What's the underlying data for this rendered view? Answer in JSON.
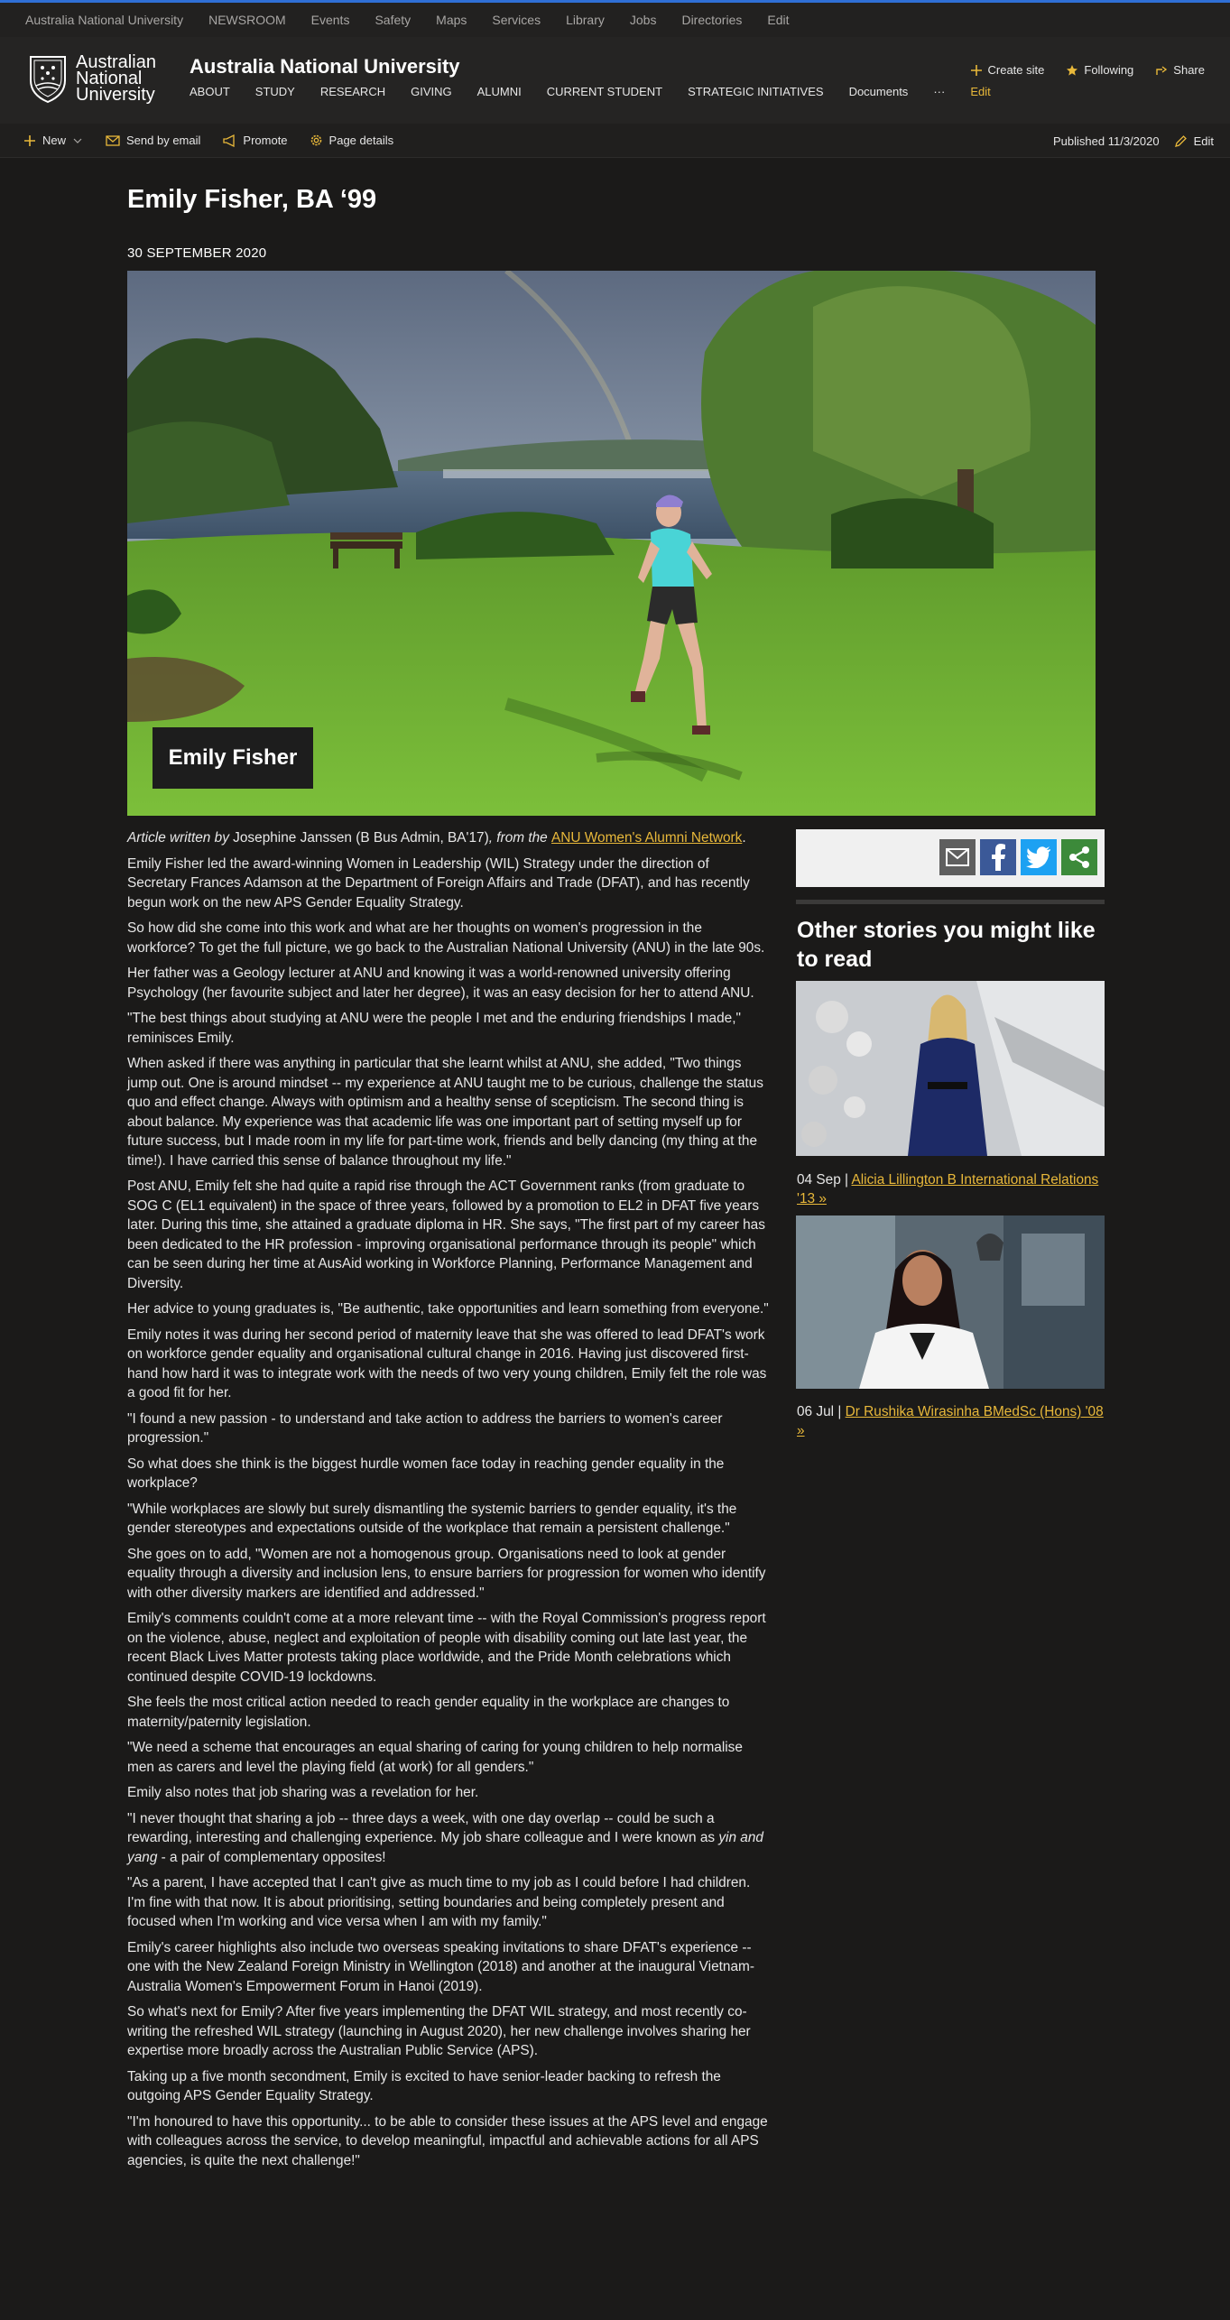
{
  "suite_bar": {
    "links": [
      "Australia National University",
      "NEWSROOM",
      "Events",
      "Safety",
      "Maps",
      "Services",
      "Library",
      "Jobs",
      "Directories",
      "Edit"
    ]
  },
  "site_header": {
    "logo_text": [
      "Australian",
      "National",
      "University"
    ],
    "title": "Australia National University",
    "nav": [
      "ABOUT",
      "STUDY",
      "RESEARCH",
      "GIVING",
      "ALUMNI",
      "CURRENT STUDENT",
      "STRATEGIC INITIATIVES",
      "Documents",
      "···",
      "Edit"
    ],
    "actions": {
      "create_site": "Create site",
      "following": "Following",
      "share": "Share"
    }
  },
  "command_bar": {
    "new": "New",
    "send_by_email": "Send by email",
    "promote": "Promote",
    "page_details": "Page details",
    "published": "Published 11/3/2020",
    "edit": "Edit"
  },
  "page": {
    "title": "Emily Fisher, BA ‘99",
    "date": "30 SEPTEMBER 2020",
    "hero_caption": "Emily Fisher"
  },
  "article": {
    "byline_prefix": "Article written by",
    "byline_author": " Josephine Janssen (B Bus Admin, BA'17)",
    "byline_mid": ", from the ",
    "byline_link": "ANU Women's Alumni Network",
    "byline_end": ".",
    "paragraphs": [
      "Emily Fisher led the award-winning Women in Leadership (WIL) Strategy under the direction of Secretary Frances Adamson at the Department of Foreign Affairs and Trade (DFAT), and has recently begun work on the new APS Gender Equality Strategy.",
      "So how did she come into this work and what are her thoughts on women's progression in the workforce? To get the full picture, we go back to the Australian National University (ANU) in the late 90s.",
      "Her father was a Geology lecturer at ANU and knowing it was a world-renowned university offering Psychology (her favourite subject and later her degree), it was an easy decision for her to attend ANU.",
      "\"The best things about studying at ANU were the people I met and the enduring friendships I made,\" reminisces Emily.",
      "When asked if there was anything in particular that she learnt whilst at ANU, she added, \"Two things jump out. One is around mindset -- my experience at ANU taught me to be curious, challenge the status quo and effect change. Always with optimism and a healthy sense of scepticism. The second thing is about balance. My experience was that academic life was one important part of setting myself up for future success, but I made room in my life for part-time work, friends and belly dancing (my thing at the time!). I have carried this sense of balance throughout my life.\"",
      "Post ANU, Emily felt she had quite a rapid rise through the ACT Government ranks (from graduate to SOG C (EL1 equivalent) in the space of three years, followed by a promotion to EL2 in DFAT five years later. During this time, she attained a graduate diploma in HR. She says, \"The first part of my career has been dedicated to the HR profession - improving organisational performance through its people\" which can be seen during her time at AusAid working in Workforce Planning, Performance Management and Diversity.",
      "Her advice to young graduates is, \"Be authentic, take opportunities and learn something from everyone.\"",
      "Emily notes it was during her second period of maternity leave that she was offered to lead DFAT's work on workforce gender equality and organisational cultural change in 2016. Having just discovered first-hand how hard it was to integrate work with the needs of two very young children, Emily felt the role was a good fit for her.",
      "\"I found a new passion - to understand and take action to address the barriers to women's career progression.\"",
      "So what does she think is the biggest hurdle women face today in reaching gender equality in the workplace?",
      "\"While workplaces are slowly but surely dismantling the systemic barriers to gender equality, it's the gender stereotypes and expectations outside of the workplace that remain a persistent challenge.\"",
      "She goes on to add, \"Women are not a homogenous group. Organisations need to look at gender equality through a diversity and inclusion lens, to ensure barriers for progression for women who identify with other diversity markers are identified and addressed.\"",
      "Emily's comments couldn't come at a more relevant time -- with the Royal Commission's progress report on the violence, abuse, neglect and exploitation of people with disability coming out late last year, the recent Black Lives Matter protests taking place worldwide, and the Pride Month celebrations which continued despite COVID-19 lockdowns.",
      "She feels the most critical action needed to reach gender equality in the workplace are changes to maternity/paternity legislation.",
      "\"We need a scheme that encourages an equal sharing of caring for young children to help normalise men as carers and level the playing field (at work) for all genders.\"",
      "Emily also notes that job sharing was a revelation for her."
    ],
    "job_share_quote_start": "\"I never thought that sharing a job -- three days a week, with one day overlap -- could be such a rewarding, interesting and challenging experience. My job share colleague and I were known as ",
    "job_share_quote_italic": "yin and yang",
    "job_share_quote_end": " - a pair of complementary opposites!",
    "paragraphs_after": [
      "\"As a parent, I have accepted that I can't give as much time to my job as I could before I had children. I'm fine with that now. It is about prioritising, setting boundaries and being completely present and focused when I'm working and vice versa when I am with my family.\"",
      "Emily's career highlights also include two overseas speaking invitations to share DFAT's experience -- one with the New Zealand Foreign Ministry in Wellington (2018) and another at the inaugural Vietnam-Australia Women's Empowerment Forum in Hanoi (2019).",
      "So what's next for Emily? After five years implementing the DFAT WIL strategy, and most recently co-writing the refreshed WIL strategy (launching in August 2020), her new challenge involves sharing her expertise more broadly across the Australian Public Service (APS).",
      "Taking up a five month secondment, Emily is excited to have senior-leader backing to refresh the outgoing APS Gender Equality Strategy.",
      "\"I'm honoured to have this opportunity... to be able to consider these issues at the APS level and engage with colleagues across the service, to develop meaningful, impactful and achievable actions for all APS agencies, is quite the next challenge!\""
    ]
  },
  "sidebar": {
    "other_title": "Other stories you might like to read",
    "stories": [
      {
        "date": "04 Sep | ",
        "link": "Alicia Lillington B International Relations '13 »"
      },
      {
        "date": "06 Jul | ",
        "link": "Dr Rushika Wirasinha BMedSc (Hons) '08 »"
      }
    ]
  },
  "colors": {
    "accent": "#e8b83a",
    "background": "#1b1a19",
    "suite_bar": "#222120"
  }
}
